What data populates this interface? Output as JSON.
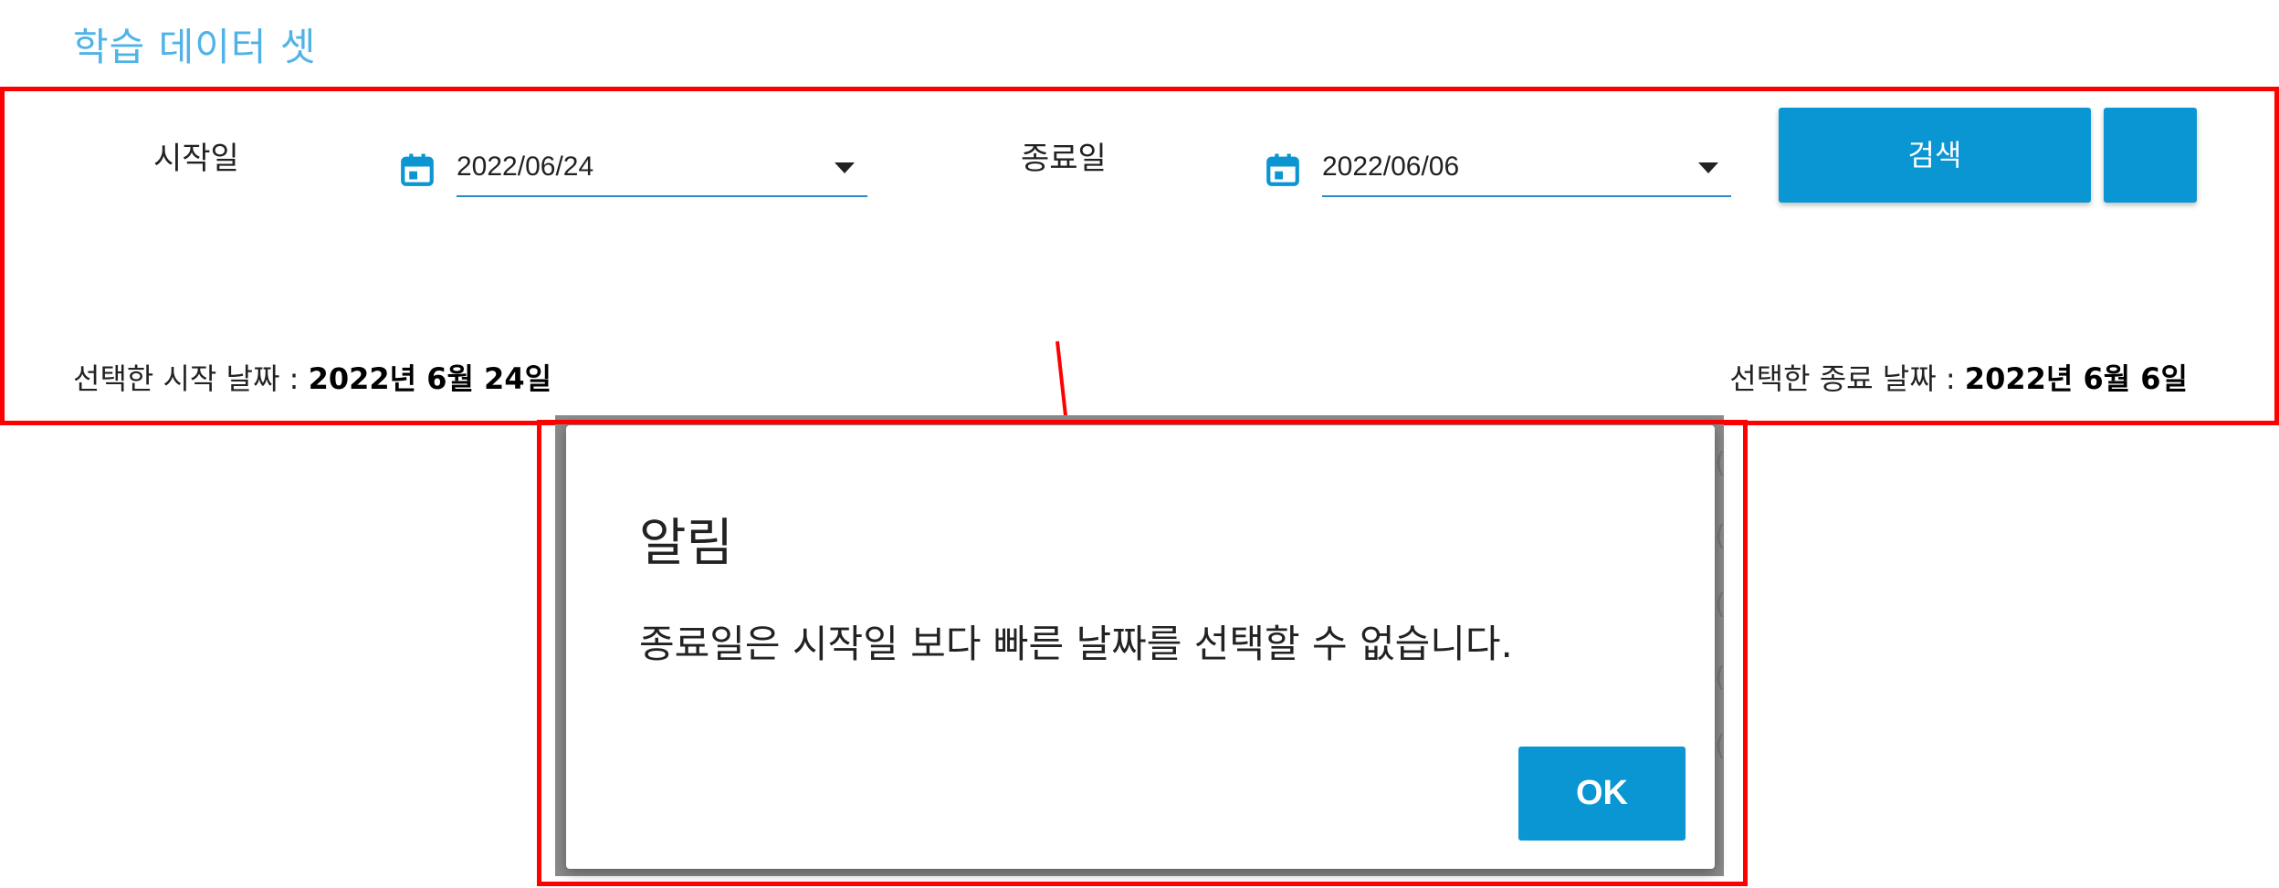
{
  "page": {
    "title": "학습 데이터 셋"
  },
  "filters": {
    "start_label": "시작일",
    "start_value": "2022/06/24",
    "end_label": "종료일",
    "end_value": "2022/06/06",
    "search_label": "검색",
    "second_button_label": ""
  },
  "summary": {
    "start_prefix": "선택한 시작 날짜 : ",
    "start_date": "2022년 6월 24일",
    "end_prefix": "선택한 종료 날짜 : ",
    "end_date": "2022년 6월 6일"
  },
  "dialog": {
    "title": "알림",
    "message": "종료일은 시작일 보다 빠른 날짜를 선택할 수 없습니다.",
    "ok_label": "OK"
  },
  "icons": {
    "calendar": "calendar-icon",
    "dropdown": "chevron-down-icon"
  },
  "colors": {
    "accent": "#0a96d2",
    "title": "#4fb3e8",
    "annotation": "#ff0000"
  }
}
